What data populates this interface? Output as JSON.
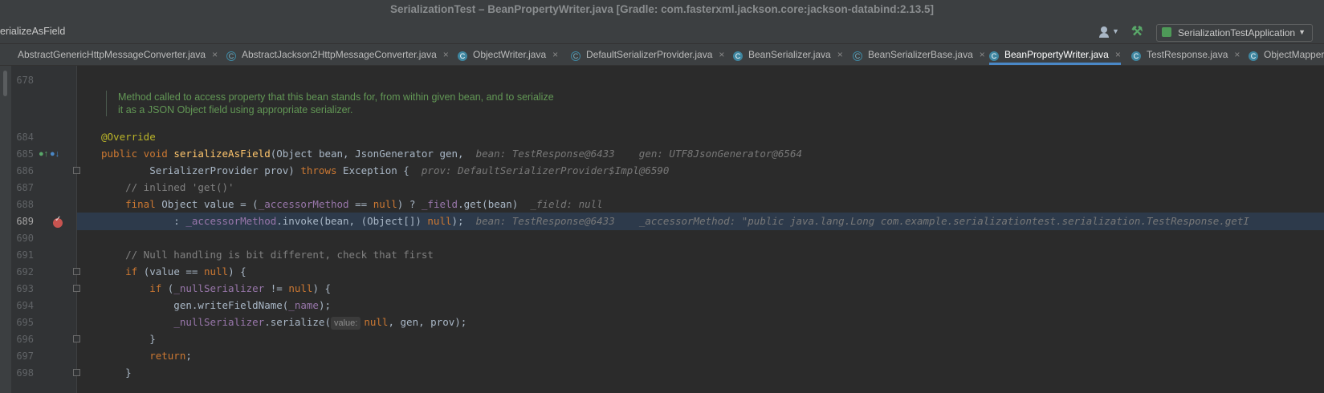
{
  "window": {
    "title": "SerializationTest – BeanPropertyWriter.java [Gradle: com.fasterxml.jackson.core:jackson-databind:2.13.5]"
  },
  "toolbar": {
    "breadcrumb": "erializeAsField",
    "run_config": "SerializationTestApplication"
  },
  "tabs": [
    {
      "label": "AbstractGenericHttpMessageConverter.java"
    },
    {
      "label": "AbstractJackson2HttpMessageConverter.java"
    },
    {
      "label": "ObjectWriter.java"
    },
    {
      "label": "DefaultSerializerProvider.java"
    },
    {
      "label": "BeanSerializer.java"
    },
    {
      "label": "BeanSerializerBase.java"
    },
    {
      "label": "BeanPropertyWriter.java"
    },
    {
      "label": "TestResponse.java"
    },
    {
      "label": "ObjectMapper."
    }
  ],
  "tab_close": "×",
  "editor": {
    "line_numbers": [
      "678",
      "684",
      "685",
      "686",
      "687",
      "688",
      "689",
      "690",
      "691",
      "692",
      "693",
      "694",
      "695",
      "696",
      "697",
      "698"
    ],
    "doc_comment": [
      "Method called to access property that this bean stands for, from within given bean, and to serialize",
      "it as a JSON Object field using appropriate serializer."
    ],
    "lines": [
      [
        [
          "ann",
          "@Override"
        ]
      ],
      [
        [
          "kw",
          "public void "
        ],
        [
          "fn",
          "serializeAsField"
        ],
        [
          "",
          "(Object bean, JsonGenerator gen,  "
        ],
        [
          "hint",
          "bean: TestResponse@6433    gen: UTF8JsonGenerator@6564"
        ]
      ],
      [
        [
          "",
          "        SerializerProvider prov) "
        ],
        [
          "kw",
          "throws "
        ],
        [
          "",
          "Exception {  "
        ],
        [
          "hint",
          "prov: DefaultSerializerProvider$Impl@6590"
        ]
      ],
      [
        [
          "cm",
          "    // inlined 'get()'"
        ]
      ],
      [
        [
          "kw",
          "    final "
        ],
        [
          "",
          "Object value = ("
        ],
        [
          "fld",
          "_accessorMethod"
        ],
        [
          "",
          " == "
        ],
        [
          "kw",
          "null"
        ],
        [
          "",
          ") ? "
        ],
        [
          "fld",
          "_field"
        ],
        [
          "",
          ".get(bean)  "
        ],
        [
          "hint",
          "_field: null"
        ]
      ],
      [
        [
          "",
          "            : "
        ],
        [
          "fld",
          "_accessorMethod"
        ],
        [
          "",
          ".invoke(bean, (Object[]) "
        ],
        [
          "kw",
          "null"
        ],
        [
          "",
          ");  "
        ],
        [
          "hint",
          "bean: TestResponse@6433    _accessorMethod: \"public java.lang.Long com.example.serializationtest.serialization.TestResponse.getI"
        ]
      ],
      [],
      [
        [
          "cm",
          "    // Null handling is bit different, check that first"
        ]
      ],
      [
        [
          "kw",
          "    if "
        ],
        [
          "",
          "(value == "
        ],
        [
          "kw",
          "null"
        ],
        [
          "",
          ") {"
        ]
      ],
      [
        [
          "kw",
          "        if "
        ],
        [
          "",
          "("
        ],
        [
          "fld",
          "_nullSerializer"
        ],
        [
          "",
          " != "
        ],
        [
          "kw",
          "null"
        ],
        [
          "",
          ") {"
        ]
      ],
      [
        [
          "",
          "            gen.writeFieldName("
        ],
        [
          "fld",
          "_name"
        ],
        [
          "",
          ");"
        ]
      ],
      [
        [
          "",
          "            "
        ],
        [
          "fld",
          "_nullSerializer"
        ],
        [
          "",
          ".serialize("
        ],
        [
          "param",
          "value:"
        ],
        [
          "kw",
          "null"
        ],
        [
          "",
          ", gen, prov);"
        ]
      ],
      [
        [
          "",
          "        }"
        ]
      ],
      [
        [
          "kw",
          "        return"
        ],
        [
          "",
          ";"
        ]
      ],
      [
        [
          "",
          "    }"
        ]
      ]
    ]
  }
}
